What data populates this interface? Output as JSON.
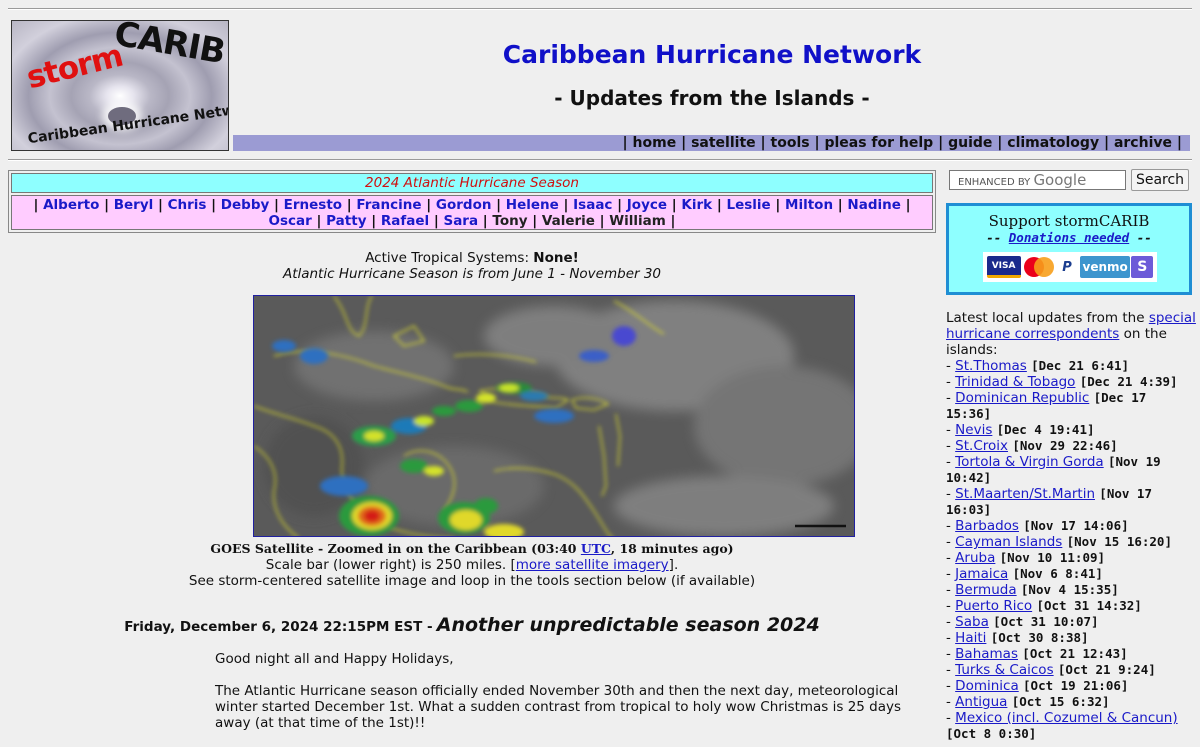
{
  "header": {
    "logo_storm": "storm",
    "logo_carib": "CARIB",
    "logo_network": "Caribbean Hurricane Network",
    "title": "Caribbean Hurricane Network",
    "subtitle": "- Updates from the Islands -",
    "nav": [
      "home",
      "satellite",
      "tools",
      "pleas for help",
      "guide",
      "climatology",
      "archive"
    ]
  },
  "season": {
    "heading": "2024 Atlantic Hurricane Season",
    "storms_used": [
      "Alberto",
      "Beryl",
      "Chris",
      "Debby",
      "Ernesto",
      "Francine",
      "Gordon",
      "Helene",
      "Isaac",
      "Joyce",
      "Kirk",
      "Leslie",
      "Milton",
      "Nadine",
      "Oscar",
      "Patty",
      "Rafael",
      "Sara"
    ],
    "storms_unused": [
      "Tony",
      "Valerie",
      "William"
    ]
  },
  "active": {
    "label": "Active Tropical Systems:",
    "value": "None!",
    "season_dates": "Atlantic Hurricane Season is from June 1 - November 30"
  },
  "satellite": {
    "caption_pre": "GOES Satellite - Zoomed in on the Caribbean (03:40",
    "caption_link": "UTC",
    "caption_post": ", 18 minutes ago)",
    "scale_pre": "Scale bar (lower right) is 250 miles. [",
    "scale_link": "more satellite imagery",
    "scale_post": "].",
    "note": "See storm-centered satellite image and loop in the tools section below (if available)"
  },
  "post": {
    "date": "Friday, December 6, 2024 22:15PM EST -",
    "title": "Another unpredictable season 2024",
    "p1": "Good night all and Happy Holidays,",
    "p2": "The Atlantic Hurricane season officially ended November 30th and then the next day, meteorological winter started December 1st. What a sudden contrast from tropical to holy wow Christmas is 25 days away (at that time of the 1st)!!"
  },
  "search": {
    "placeholder_small": "ENHANCED BY",
    "placeholder_brand": "Google",
    "button": "Search"
  },
  "support": {
    "title": "Support stormCARIB",
    "donations": "Donations needed",
    "dash": "--",
    "cards": [
      "VISA",
      "PayPal",
      "venmo",
      "S"
    ]
  },
  "updates": {
    "intro_pre": "Latest local updates from the",
    "intro_link": "special hurricane correspondents",
    "intro_post": "on the islands:",
    "items": [
      {
        "name": "St.Thomas",
        "ts": "[Dec 21 6:41]"
      },
      {
        "name": "Trinidad & Tobago",
        "ts": "[Dec 21 4:39]"
      },
      {
        "name": "Dominican Republic",
        "ts": "[Dec 17 15:36]"
      },
      {
        "name": "Nevis",
        "ts": "[Dec 4 19:41]"
      },
      {
        "name": "St.Croix",
        "ts": "[Nov 29 22:46]"
      },
      {
        "name": "Tortola & Virgin Gorda",
        "ts": "[Nov 19 10:42]"
      },
      {
        "name": "St.Maarten/St.Martin",
        "ts": "[Nov 17 16:03]"
      },
      {
        "name": "Barbados",
        "ts": "[Nov 17 14:06]"
      },
      {
        "name": "Cayman Islands",
        "ts": "[Nov 15 16:20]"
      },
      {
        "name": "Aruba",
        "ts": "[Nov 10 11:09]"
      },
      {
        "name": "Jamaica",
        "ts": "[Nov 6 8:41]"
      },
      {
        "name": "Bermuda",
        "ts": "[Nov 4 15:35]"
      },
      {
        "name": "Puerto Rico",
        "ts": "[Oct 31 14:32]"
      },
      {
        "name": "Saba",
        "ts": "[Oct 31 10:07]"
      },
      {
        "name": "Haiti",
        "ts": "[Oct 30 8:38]"
      },
      {
        "name": "Bahamas",
        "ts": "[Oct 21 12:43]"
      },
      {
        "name": "Turks & Caicos",
        "ts": "[Oct 21 9:24]"
      },
      {
        "name": "Dominica",
        "ts": "[Oct 19 21:06]"
      },
      {
        "name": "Antigua",
        "ts": "[Oct 15 6:32]"
      },
      {
        "name": "Mexico (incl. Cozumel & Cancun)",
        "ts": "[Oct 8 0:30]"
      }
    ]
  }
}
